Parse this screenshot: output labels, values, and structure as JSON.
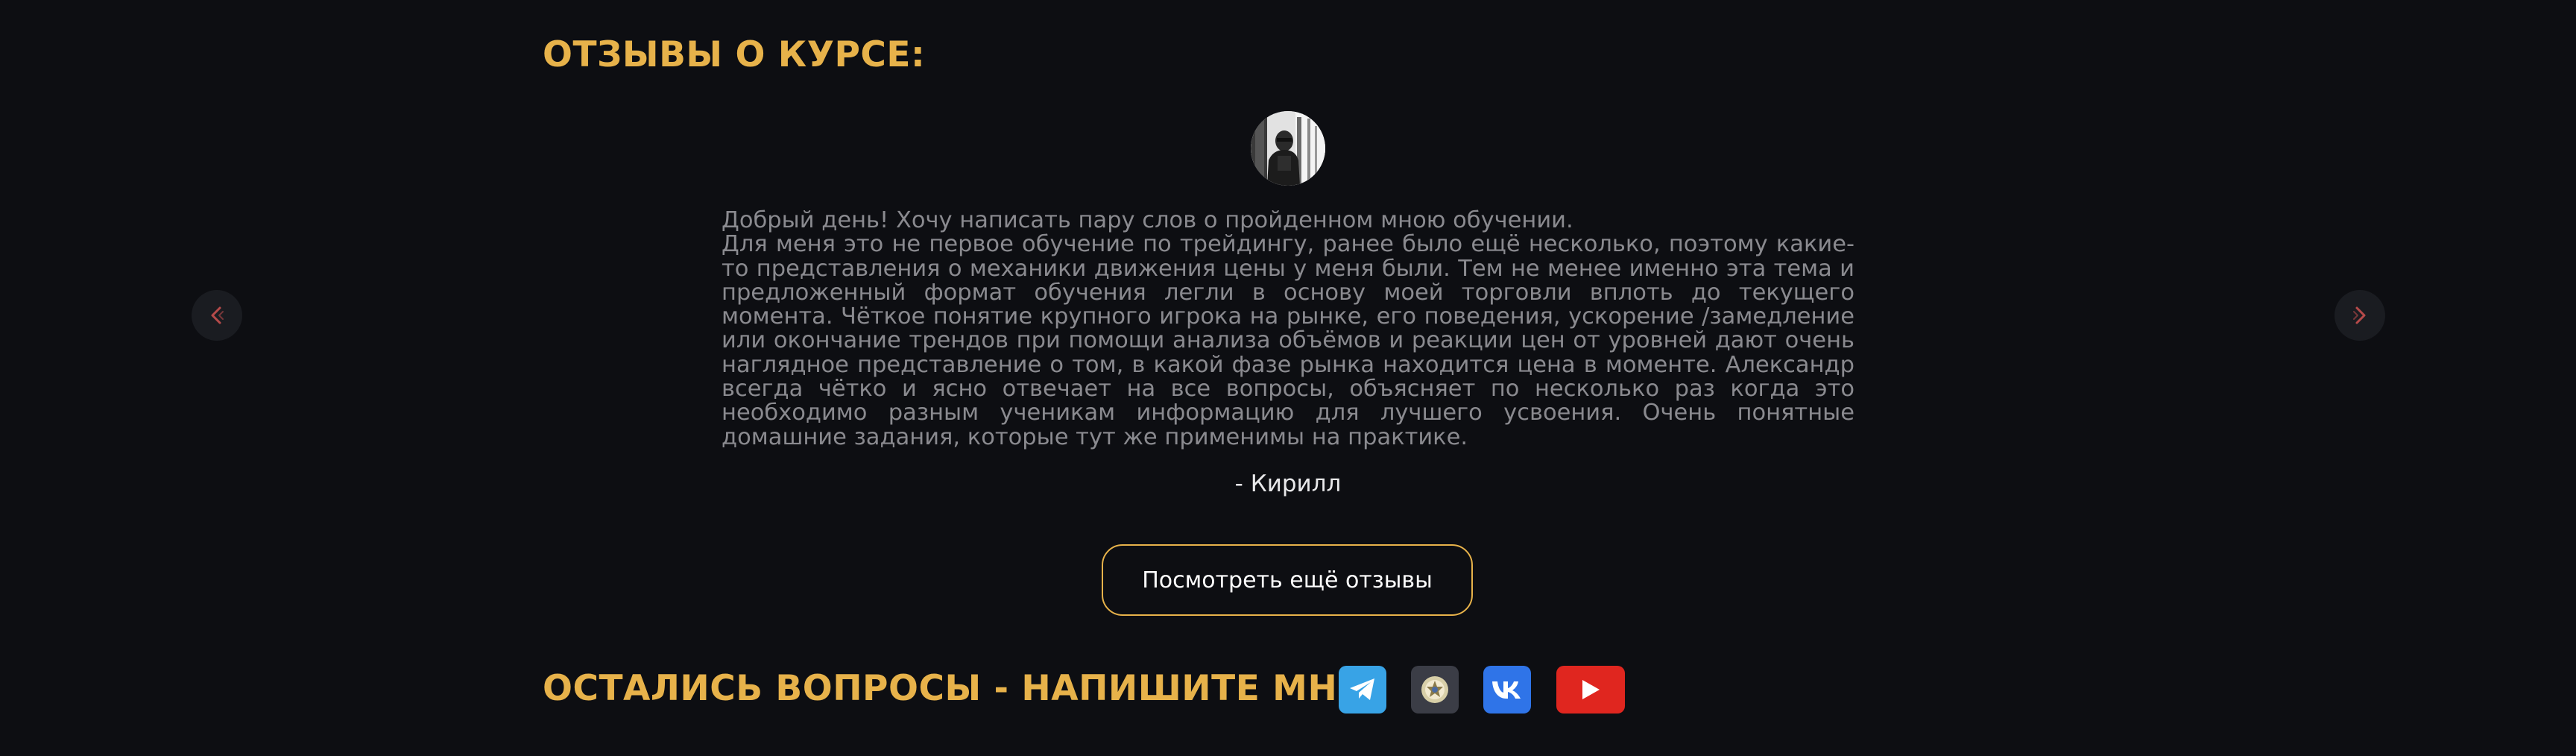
{
  "reviews_section": {
    "title": "ОТЗЫВЫ О КУРСЕ:",
    "review": {
      "lines": [
        "Добрый день! Хочу написать пару слов о пройденном мною обучении.",
        "Для меня это не первое обучение по трейдингу, ранее было ещё несколько, поэтому какие-то представления о механики движения цены у меня были. Тем не менее именно эта тема и предложенный формат обучения легли в основу моей торговли вплоть до текущего момента. Чёткое понятие крупного игрока на рынке, его поведения, ускорение /замедление или окончание трендов при помощи анализа объёмов и реакции цен от уровней дают очень наглядное представление о том, в какой фазе рынка находится цена в моменте. Александр всегда чётко и ясно отвечает на все вопросы, объясняет по несколько раз когда это необходимо разным ученикам информацию для лучшего усвоения. Очень понятные домашние задания, которые тут же применимы на практике."
      ],
      "author": "- Кирилл"
    },
    "more_button_label": "Посмотреть ещё отзывы"
  },
  "contact_section": {
    "title": "ОСТАЛИСЬ ВОПРОСЫ - НАПИШИТЕ МНЕ:",
    "socials": [
      {
        "name": "telegram",
        "icon": "telegram-icon",
        "color": "#38a3e6"
      },
      {
        "name": "emblem",
        "icon": "emblem-icon",
        "color": "#3b3d46"
      },
      {
        "name": "vk",
        "icon": "vk-icon",
        "color": "#2f74e8"
      },
      {
        "name": "youtube",
        "icon": "youtube-icon",
        "color": "#e0261f"
      }
    ]
  },
  "colors": {
    "background": "#0d0e12",
    "accent": "#e7b24a",
    "arrow": "#b64a4a"
  }
}
